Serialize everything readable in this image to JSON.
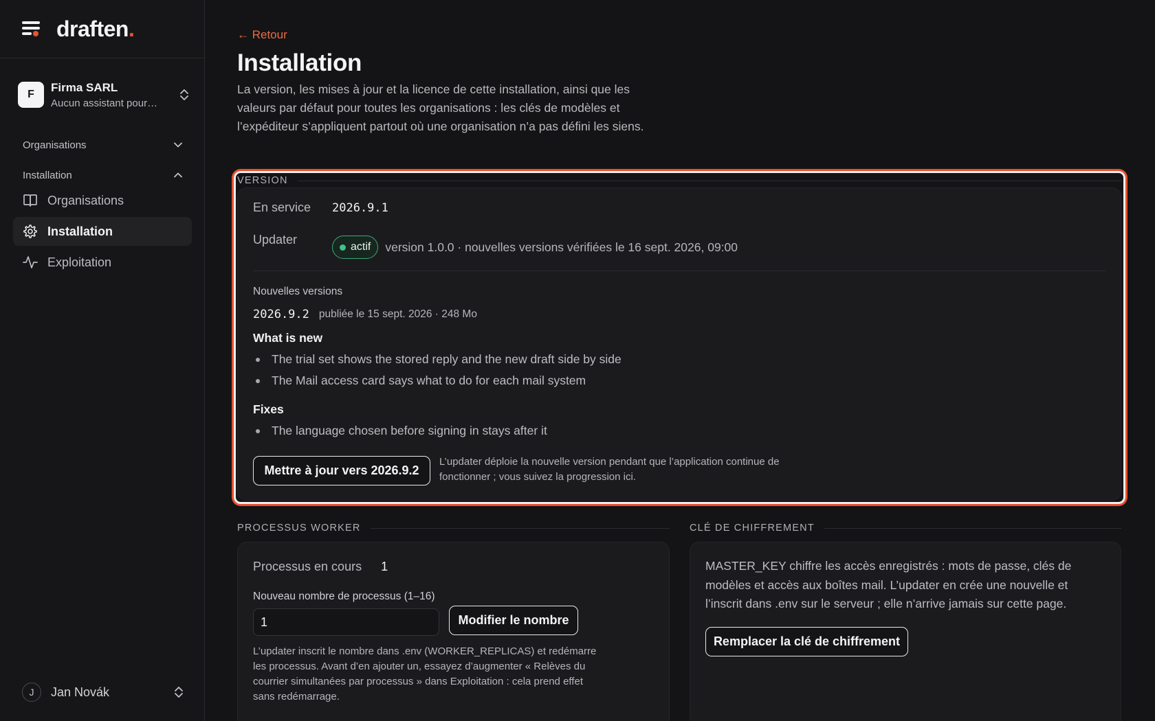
{
  "brand": {
    "name": "draften",
    "dot": "."
  },
  "org": {
    "initial": "F",
    "name": "Firma SARL",
    "subtitle": "Aucun assistant pour…"
  },
  "sidebar": {
    "groups": [
      {
        "label": "Organisations",
        "expanded": false
      },
      {
        "label": "Installation",
        "expanded": true
      }
    ],
    "items": [
      {
        "label": "Organisations",
        "icon": "book-icon",
        "active": false
      },
      {
        "label": "Installation",
        "icon": "gear-icon",
        "active": true
      },
      {
        "label": "Exploitation",
        "icon": "activity-icon",
        "active": false
      }
    ]
  },
  "user": {
    "initial": "J",
    "name": "Jan Novák"
  },
  "page": {
    "back_label": "← Retour",
    "title": "Installation",
    "intro": "La version, les mises à jour et la licence de cette installation, ainsi que les valeurs par défaut pour toutes les organisations : les clés de modèles et l’expéditeur s’appliquent partout où une organisation n’a pas défini les siens."
  },
  "version": {
    "section_title": "VERSION",
    "in_service_label": "En service",
    "in_service_value": "2026.9.1",
    "updater_label": "Updater",
    "updater_status": "actif",
    "updater_info": "version 1.0.0 · nouvelles versions vérifiées le 16 sept. 2026, 09:00",
    "new_versions_label": "Nouvelles versions",
    "new_version": "2026.9.2",
    "new_version_meta": "publiée le 15 sept. 2026 · 248 Mo",
    "whats_new_title": "What is new",
    "whats_new": [
      "The trial set shows the stored reply and the new draft side by side",
      "The Mail access card says what to do for each mail system"
    ],
    "fixes_title": "Fixes",
    "fixes": [
      "The language chosen before signing in stays after it"
    ],
    "update_button": "Mettre à jour vers 2026.9.2",
    "update_note": "L’updater déploie la nouvelle version pendant que l’application continue de fonctionner ; vous suivez la progression ici."
  },
  "worker": {
    "section_title": "PROCESSUS WORKER",
    "running_label": "Processus en cours",
    "running_value": "1",
    "new_count_label": "Nouveau nombre de processus (1–16)",
    "new_count_value": "1",
    "modify_button": "Modifier le nombre",
    "note": "L’updater inscrit le nombre dans .env (WORKER_REPLICAS) et redémarre les processus. Avant d’en ajouter un, essayez d’augmenter « Relèves du courrier simultanées par processus » dans Exploitation : cela prend effet sans redémarrage."
  },
  "encryption": {
    "section_title": "CLÉ DE CHIFFREMENT",
    "body": "MASTER_KEY chiffre les accès enregistrés : mots de passe, clés de modèles et accès aux boîtes mail. L’updater en crée une nouvelle et l’inscrit dans .env sur le serveur ; elle n’arrive jamais sur cette page.",
    "replace_button": "Remplacer la clé de chiffrement"
  },
  "colors": {
    "accent": "#ee5230",
    "back_link": "#ee6a44",
    "status_ok": "#3ec486",
    "background": "#141416",
    "card": "#1b1b1e"
  }
}
